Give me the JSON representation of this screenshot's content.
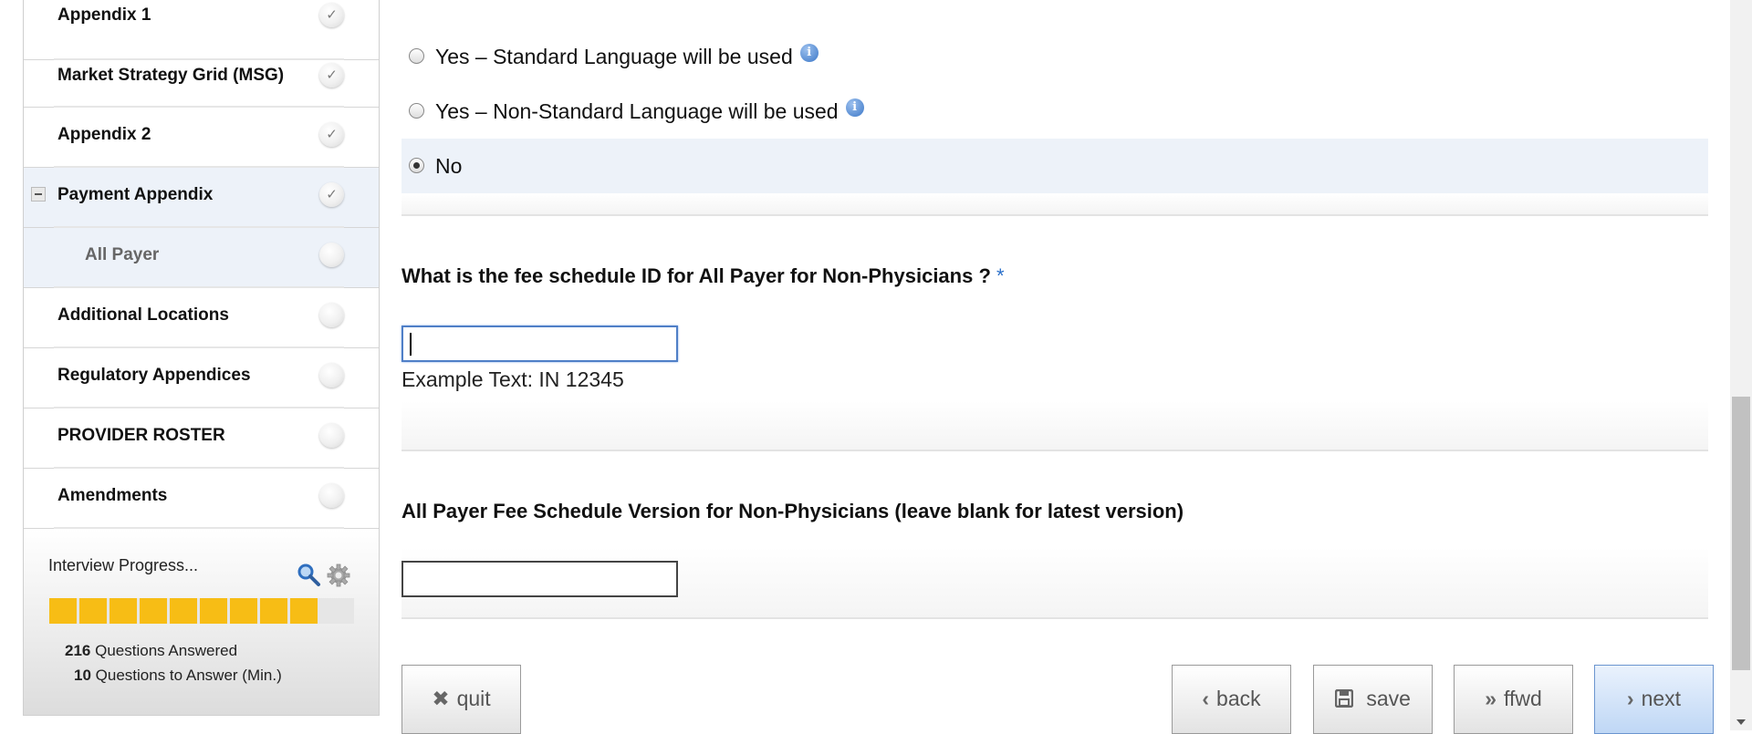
{
  "sidebar": {
    "items": [
      {
        "label": "Appendix 1",
        "status": "✓"
      },
      {
        "label": "Market Strategy Grid (MSG)",
        "status": "✓"
      },
      {
        "label": "Appendix 2",
        "status": "✓"
      },
      {
        "label": "Payment Appendix",
        "status": "✓"
      },
      {
        "label": "All Payer",
        "status": ""
      },
      {
        "label": "Additional Locations",
        "status": ""
      },
      {
        "label": "Regulatory Appendices",
        "status": ""
      },
      {
        "label": "PROVIDER ROSTER",
        "status": ""
      },
      {
        "label": "Amendments",
        "status": ""
      }
    ],
    "progress": {
      "title": "Interview Progress...",
      "filled_segments": 9,
      "total_segments": 10,
      "answered_count": "216",
      "answered_label": "Questions Answered",
      "remaining_count": "10",
      "remaining_label": "Questions to Answer (Min.)"
    }
  },
  "main": {
    "options": [
      {
        "label": "Yes – Standard Language will be used",
        "info": "i"
      },
      {
        "label": "Yes – Non-Standard Language will be used",
        "info": "i"
      },
      {
        "label": "No"
      }
    ],
    "question1": {
      "text": "What is the fee schedule ID for All Payer for Non-Physicians ?",
      "required_mark": "*",
      "value": "",
      "example": "Example Text: IN 12345"
    },
    "question2": {
      "text": "All Payer Fee Schedule Version for Non-Physicians (leave blank for latest version)",
      "value": ""
    },
    "buttons": {
      "quit": "quit",
      "back": "back",
      "save": "save",
      "ffwd": "ffwd",
      "next": "next"
    }
  },
  "colors": {
    "selected_bg": "#edf2f9",
    "progress_fill": "#f7bd15",
    "accent": "#2a6fc9"
  }
}
